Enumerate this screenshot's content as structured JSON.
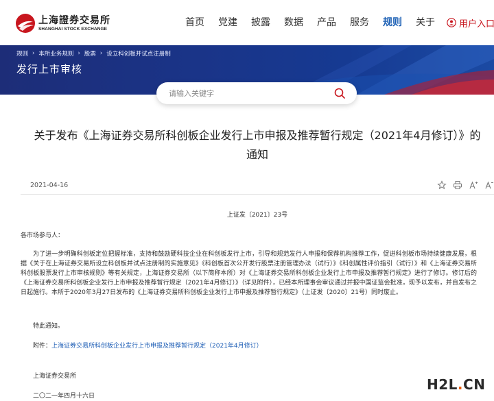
{
  "header": {
    "logo_cn": "上海證券交易所",
    "logo_en": "SHANGHAI STOCK EXCHANGE",
    "nav": [
      "首页",
      "党建",
      "披露",
      "数据",
      "产品",
      "服务",
      "规则",
      "关于"
    ],
    "active_nav": "规则",
    "login_label": "用户入口"
  },
  "banner": {
    "breadcrumbs": [
      "规则",
      "本所业务规则",
      "股票",
      "设立科创板并试点注册制"
    ],
    "title": "发行上市审核"
  },
  "search": {
    "placeholder": "请输入关键字"
  },
  "article": {
    "title_line1": "关于发布《上海证券交易所科创板企业发行上市申报及推荐暂行规定（2021年4月修订）》的",
    "title_line2": "通知",
    "date": "2021-04-16",
    "doc_number": "上证发〔2021〕23号",
    "salutation": "各市场参与人：",
    "body": "为了进一步明确科创板定位把握标准，支持和鼓励硬科技企业在科创板发行上市，引导和规范发行人申报和保荐机构推荐工作，促进科创板市场持续健康发展，根据《关于在上海证券交易所设立科创板并试点注册制的实施意见》《科创板首次公开发行股票注册管理办法（试行）》《科创属性评价指引（试行）》和《上海证券交易所科创板股票发行上市审核规则》等有关规定，上海证券交易所（以下简称本所）对《上海证券交易所科创板企业发行上市申报及推荐暂行规定》进行了修订。修订后的《上海证券交易所科创板企业发行上市申报及推荐暂行规定（2021年4月修订）》（详见附件），已经本所理事会审议通过并报中国证监会批准，现予以发布，并自发布之日起施行。本所于2020年3月27日发布的《上海证券交易所科创板企业发行上市申报及推荐暂行规定》（上证发〔2020〕21号）同时废止。",
    "closing": "特此通知。",
    "attachment_label": "附件：",
    "attachment_link": "上海证券交易所科创板企业发行上市申报及推荐暂行规定（2021年4月修订）",
    "organization": "上海证券交易所",
    "sign_date": "二〇二一年四月十六日"
  },
  "tools": [
    "star-icon",
    "print-icon",
    "font-increase-icon",
    "font-decrease-icon"
  ],
  "watermark": {
    "part1": "H2L",
    "dot": ".",
    "part2": "CN"
  },
  "colors": {
    "brand_red": "#c8161e",
    "nav_active": "#1b5fb4",
    "banner_blue": "#1a3488",
    "link_blue": "#1f5fb6"
  }
}
